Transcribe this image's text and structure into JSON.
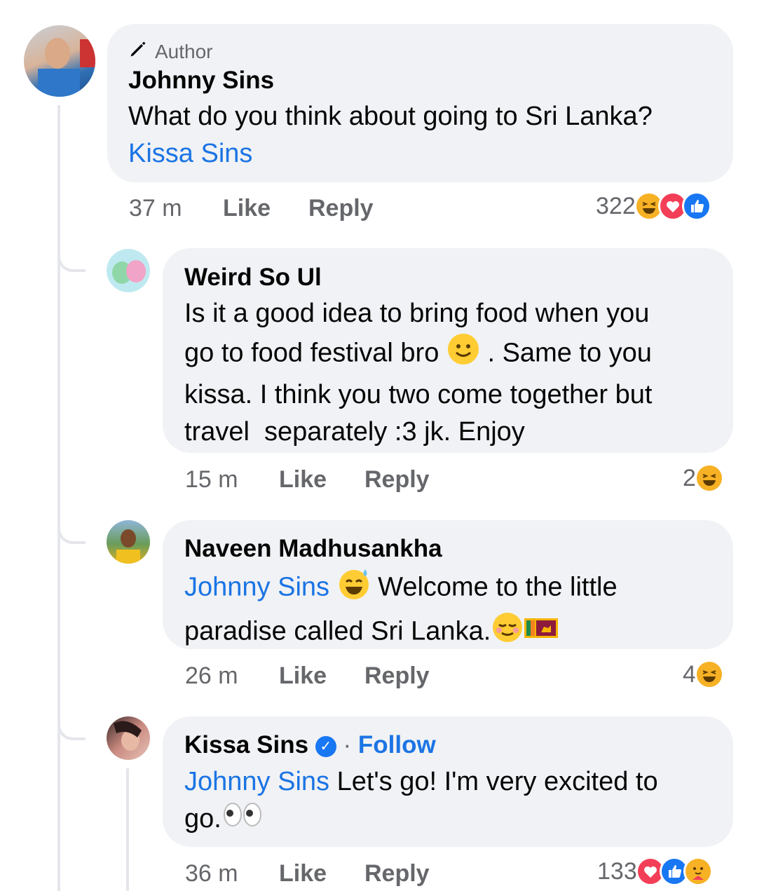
{
  "comments": [
    {
      "author_badge": "Author",
      "name": "Johnny Sins",
      "text": "What do you think about going to Sri Lanka?",
      "mention": "Kissa Sins",
      "time": "37 m",
      "like_label": "Like",
      "reply_label": "Reply",
      "reaction_count": "322",
      "reactions": [
        "haha",
        "love",
        "like"
      ]
    },
    {
      "name": "Weird So Ul",
      "line1": "Is it a good idea to bring food when you",
      "line2a": "go to food festival bro",
      "line2b": ". Same to you",
      "line3": "kissa. I think you two come together but",
      "line4": "travel  separately :3 jk. Enjoy",
      "time": "15 m",
      "like_label": "Like",
      "reply_label": "Reply",
      "reaction_count": "2",
      "reactions": [
        "haha"
      ]
    },
    {
      "name": "Naveen Madhusankha",
      "mention": "Johnny Sins",
      "line1": "Welcome to the little",
      "line2": "paradise called Sri Lanka.",
      "time": "26 m",
      "like_label": "Like",
      "reply_label": "Reply",
      "reaction_count": "4",
      "reactions": [
        "haha"
      ]
    },
    {
      "name": "Kissa Sins",
      "follow_sep": "·",
      "follow_label": "Follow",
      "mention": "Johnny Sins",
      "line1": "Let's go! I'm very excited to",
      "line2": "go.",
      "time": "36 m",
      "like_label": "Like",
      "reply_label": "Reply",
      "reaction_count": "133",
      "reactions": [
        "love",
        "like",
        "care"
      ]
    }
  ],
  "colors": {
    "link": "#1b74e4",
    "bubble": "#f0f2f5",
    "meta": "#65676b",
    "like_blue": "#1877f2",
    "love_red": "#f33e58",
    "haha_yellow": "#f7b125"
  }
}
